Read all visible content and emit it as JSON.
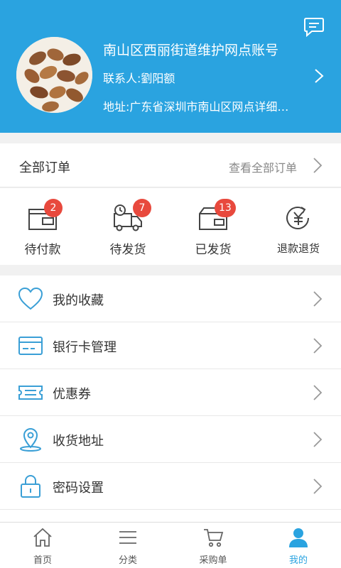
{
  "header": {
    "account_name": "南山区西丽街道维护网点账号",
    "contact": "联系人:劉阳额",
    "address": "地址:广东省深圳市南山区网点详细…",
    "bg_color": "#2aa3e0"
  },
  "orders": {
    "title": "全部订单",
    "view_all": "查看全部订单"
  },
  "order_status": [
    {
      "label": "待付款",
      "badge": "2",
      "icon": "wallet-icon"
    },
    {
      "label": "待发货",
      "badge": "7",
      "icon": "delivery-truck-icon"
    },
    {
      "label": "已发货",
      "badge": "13",
      "icon": "package-icon"
    },
    {
      "label": "退款退货",
      "badge": "",
      "icon": "refund-yuan-icon"
    }
  ],
  "menu": [
    {
      "label": "我的收藏",
      "icon": "heart-icon"
    },
    {
      "label": "银行卡管理",
      "icon": "bank-card-icon"
    },
    {
      "label": "优惠券",
      "icon": "coupon-icon"
    },
    {
      "label": "收货地址",
      "icon": "location-pin-icon"
    },
    {
      "label": "密码设置",
      "icon": "lock-icon"
    }
  ],
  "tabbar": [
    {
      "label": "首页",
      "icon": "home-icon",
      "active": false
    },
    {
      "label": "分类",
      "icon": "list-icon",
      "active": false
    },
    {
      "label": "采购单",
      "icon": "cart-icon",
      "active": false
    },
    {
      "label": "我的",
      "icon": "user-icon",
      "active": true
    }
  ],
  "colors": {
    "accent": "#2aa3e0",
    "badge": "#e8493d",
    "icon_blue": "#3a9fd6"
  }
}
